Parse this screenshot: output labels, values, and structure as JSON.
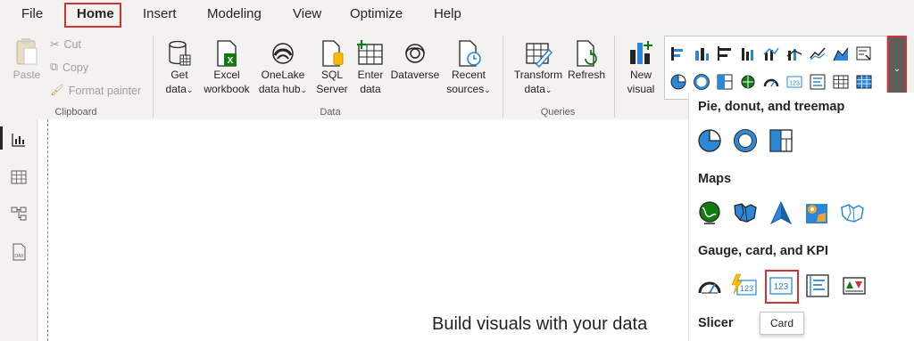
{
  "menu": {
    "items": [
      "File",
      "Home",
      "Insert",
      "Modeling",
      "View",
      "Optimize",
      "Help"
    ],
    "active": "Home"
  },
  "ribbon": {
    "clipboard": {
      "paste": "Paste",
      "cut": "Cut",
      "copy": "Copy",
      "format_painter": "Format painter",
      "label": "Clipboard"
    },
    "data": {
      "get_data": [
        "Get",
        "data"
      ],
      "excel": [
        "Excel",
        "workbook"
      ],
      "onelake": [
        "OneLake",
        "data hub"
      ],
      "sql": [
        "SQL",
        "Server"
      ],
      "enter": [
        "Enter",
        "data"
      ],
      "dataverse": "Dataverse",
      "recent": [
        "Recent",
        "sources"
      ],
      "label": "Data"
    },
    "queries": {
      "transform": [
        "Transform",
        "data"
      ],
      "refresh": "Refresh",
      "label": "Queries"
    },
    "insert": {
      "new_visual": [
        "New",
        "visual"
      ]
    }
  },
  "canvas": {
    "prompt": "Build visuals with your data"
  },
  "panel": {
    "sections": [
      "Pie, donut, and treemap",
      "Maps",
      "Gauge, card, and KPI",
      "Slicer"
    ],
    "tooltip": "Card"
  },
  "colors": {
    "accent_red": "#d13438",
    "blue": "#2b88d8",
    "green": "#107c10",
    "dark": "#252423"
  }
}
